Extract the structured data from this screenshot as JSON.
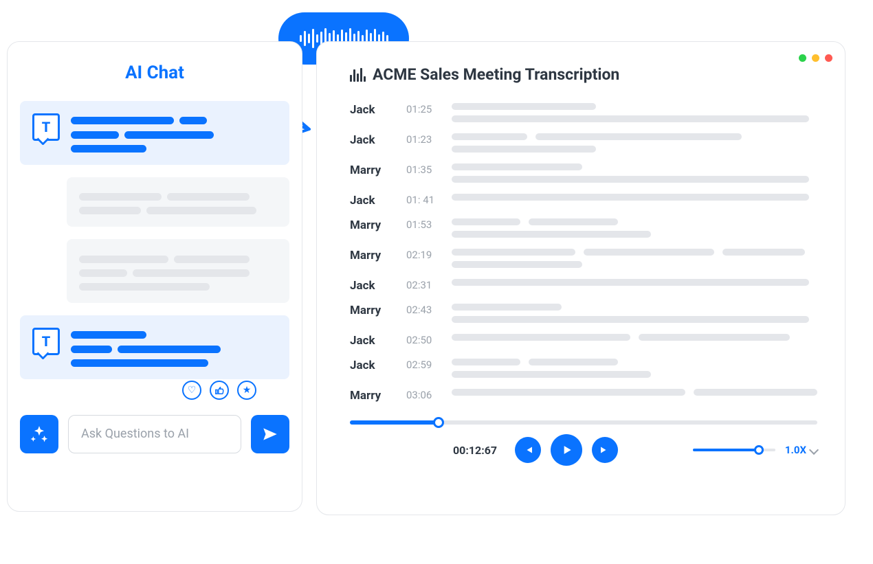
{
  "chat": {
    "title": "AI Chat",
    "input_placeholder": "Ask Questions to AI"
  },
  "icons": {
    "magic": "sparkle-icon",
    "send": "send-icon",
    "heart": "heart-icon",
    "like": "thumbs-up-icon",
    "star": "star-icon",
    "prev": "skip-back-icon",
    "play": "play-icon",
    "next": "skip-forward-icon",
    "wave": "audio-wave-icon",
    "chevron": "chevron-down-icon"
  },
  "transcription": {
    "title": "ACME Sales Meeting Transcription",
    "rows": [
      {
        "speaker": "Jack",
        "time": "01:25"
      },
      {
        "speaker": "Jack",
        "time": "01:23"
      },
      {
        "speaker": "Marry",
        "time": "01:35"
      },
      {
        "speaker": "Jack",
        "time": "01: 41"
      },
      {
        "speaker": "Marry",
        "time": "01:53"
      },
      {
        "speaker": "Marry",
        "time": "02:19"
      },
      {
        "speaker": "Jack",
        "time": "02:31"
      },
      {
        "speaker": "Marry",
        "time": "02:43"
      },
      {
        "speaker": "Jack",
        "time": "02:50"
      },
      {
        "speaker": "Jack",
        "time": "02:59"
      },
      {
        "speaker": "Marry",
        "time": "03:06"
      }
    ],
    "player": {
      "elapsed": "00:12:67",
      "progress_pct": 19,
      "speed_label": "1.0X",
      "speed_pct": 80
    }
  }
}
